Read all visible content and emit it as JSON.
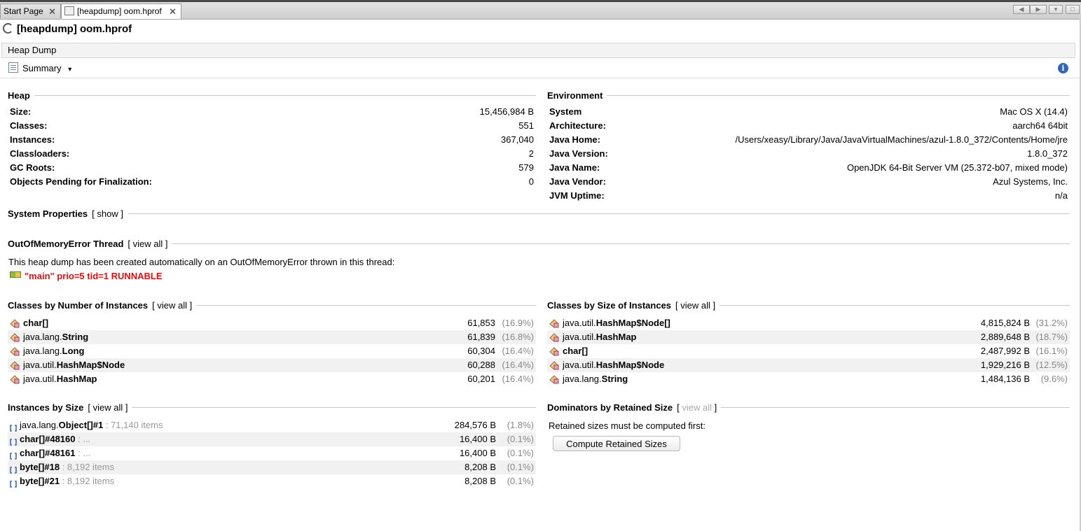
{
  "tabs": [
    {
      "label": "Start Page",
      "close": "✕"
    },
    {
      "label": "[heapdump] oom.hprof",
      "close": "✕"
    }
  ],
  "window_controls": [
    "◀",
    "▶",
    "▾",
    "□"
  ],
  "title": "[heapdump] oom.hprof",
  "subtitle": "Heap Dump",
  "view_selector": {
    "label": "Summary",
    "arrow": "▾"
  },
  "info_icon": "i",
  "heap": {
    "heading": "Heap",
    "rows": [
      {
        "k": "Size:",
        "v": "15,456,984 B"
      },
      {
        "k": "Classes:",
        "v": "551"
      },
      {
        "k": "Instances:",
        "v": "367,040"
      },
      {
        "k": "Classloaders:",
        "v": "2"
      },
      {
        "k": "GC Roots:",
        "v": "579"
      },
      {
        "k": "Objects Pending for Finalization:",
        "v": "0"
      }
    ]
  },
  "environment": {
    "heading": "Environment",
    "rows": [
      {
        "k": "System",
        "v": "Mac OS X (14.4)"
      },
      {
        "k": "Architecture:",
        "v": "aarch64 64bit"
      },
      {
        "k": "Java Home:",
        "v": "/Users/xeasy/Library/Java/JavaVirtualMachines/azul-1.8.0_372/Contents/Home/jre"
      },
      {
        "k": "Java Version:",
        "v": "1.8.0_372"
      },
      {
        "k": "Java Name:",
        "v": "OpenJDK 64-Bit Server VM (25.372-b07, mixed mode)"
      },
      {
        "k": "Java Vendor:",
        "v": "Azul Systems, Inc."
      },
      {
        "k": "JVM Uptime:",
        "v": "n/a"
      }
    ]
  },
  "system_properties": {
    "heading": "System Properties",
    "link": "[ show ]"
  },
  "oom_thread": {
    "heading": "OutOfMemoryError Thread",
    "link": "[ view all ]",
    "message": "This heap dump has been created automatically on an OutOfMemoryError thrown in this thread:",
    "thread": "\"main\" prio=5 tid=1 RUNNABLE"
  },
  "classes_by_count": {
    "heading": "Classes by Number of Instances",
    "link": "[ view all ]",
    "rows": [
      {
        "pkg": "",
        "cls": "char[]",
        "val": "61,853",
        "pct": "(16.9%)"
      },
      {
        "pkg": "java.lang.",
        "cls": "String",
        "val": "61,839",
        "pct": "(16.8%)"
      },
      {
        "pkg": "java.lang.",
        "cls": "Long",
        "val": "60,304",
        "pct": "(16.4%)"
      },
      {
        "pkg": "java.util.",
        "cls": "HashMap$Node",
        "val": "60,288",
        "pct": "(16.4%)"
      },
      {
        "pkg": "java.util.",
        "cls": "HashMap",
        "val": "60,201",
        "pct": "(16.4%)"
      }
    ]
  },
  "classes_by_size": {
    "heading": "Classes by Size of Instances",
    "link": "[ view all ]",
    "rows": [
      {
        "pkg": "java.util.",
        "cls": "HashMap$Node[]",
        "val": "4,815,824 B",
        "pct": "(31.2%)"
      },
      {
        "pkg": "java.util.",
        "cls": "HashMap",
        "val": "2,889,648 B",
        "pct": "(18.7%)"
      },
      {
        "pkg": "",
        "cls": "char[]",
        "val": "2,487,992 B",
        "pct": "(16.1%)"
      },
      {
        "pkg": "java.util.",
        "cls": "HashMap$Node",
        "val": "1,929,216 B",
        "pct": "(12.5%)"
      },
      {
        "pkg": "java.lang.",
        "cls": "String",
        "val": "1,484,136 B",
        "pct": "(9.6%)"
      }
    ]
  },
  "instances_by_size": {
    "heading": "Instances by Size",
    "link": "[ view all ]",
    "rows": [
      {
        "pkg": "java.lang.",
        "cls": "Object[]#1",
        "extra": " : 71,140 items",
        "val": "284,576 B",
        "pct": "(1.8%)"
      },
      {
        "pkg": "",
        "cls": "char[]#48160",
        "extra": " : ...",
        "val": "16,400 B",
        "pct": "(0.1%)"
      },
      {
        "pkg": "",
        "cls": "char[]#48161",
        "extra": " : ...",
        "val": "16,400 B",
        "pct": "(0.1%)"
      },
      {
        "pkg": "",
        "cls": "byte[]#18",
        "extra": " : 8,192 items",
        "val": "8,208 B",
        "pct": "(0.1%)"
      },
      {
        "pkg": "",
        "cls": "byte[]#21",
        "extra": " : 8,192 items",
        "val": "8,208 B",
        "pct": "(0.1%)"
      }
    ]
  },
  "dominators": {
    "heading": "Dominators by Retained Size",
    "link_open": "[",
    "link_text": " view all ",
    "link_close": "]",
    "message": "Retained sizes must be computed first:",
    "button": "Compute Retained Sizes"
  }
}
